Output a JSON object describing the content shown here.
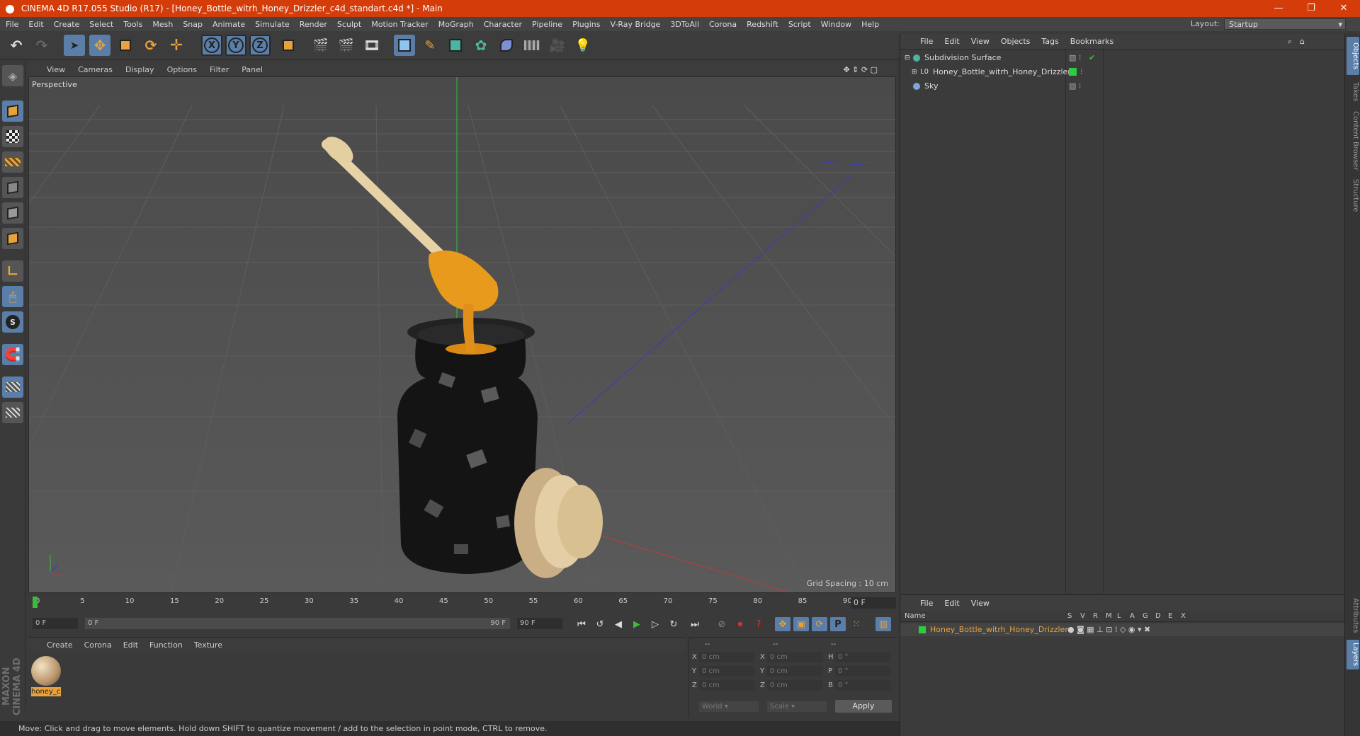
{
  "window": {
    "title": "CINEMA 4D R17.055 Studio (R17) - [Honey_Bottle_witrh_Honey_Drizzler_c4d_standart.c4d *] - Main",
    "minimize": "—",
    "restore": "❐",
    "close": "✕"
  },
  "menu": [
    "File",
    "Edit",
    "Create",
    "Select",
    "Tools",
    "Mesh",
    "Snap",
    "Animate",
    "Simulate",
    "Render",
    "Sculpt",
    "Motion Tracker",
    "MoGraph",
    "Character",
    "Pipeline",
    "Plugins",
    "V-Ray Bridge",
    "3DToAll",
    "Corona",
    "Redshift",
    "Script",
    "Window",
    "Help"
  ],
  "layout": {
    "label": "Layout:",
    "value": "Startup"
  },
  "toolbar": {
    "x_label": "X",
    "y_label": "Y",
    "z_label": "Z"
  },
  "viewport": {
    "menu": [
      "View",
      "Cameras",
      "Display",
      "Options",
      "Filter",
      "Panel"
    ],
    "label": "Perspective",
    "grid_spacing": "Grid Spacing : 10 cm"
  },
  "timeline": {
    "ticks": [
      "0",
      "5",
      "10",
      "15",
      "20",
      "25",
      "30",
      "35",
      "40",
      "45",
      "50",
      "55",
      "60",
      "65",
      "70",
      "75",
      "80",
      "85",
      "90"
    ],
    "current_frame": "0 F",
    "start_field": "0 F",
    "range_start": "0 F",
    "range_end": "90 F",
    "end_field": "90 F"
  },
  "materials": {
    "menu": [
      "Create",
      "Corona",
      "Edit",
      "Function",
      "Texture"
    ],
    "items": [
      {
        "name": "honey_c"
      }
    ]
  },
  "coords": {
    "header": [
      "--",
      "--",
      "--"
    ],
    "rows": [
      {
        "a": "X",
        "av": "0 cm",
        "b": "X",
        "bv": "0 cm",
        "c": "H",
        "cv": "0 °"
      },
      {
        "a": "Y",
        "av": "0 cm",
        "b": "Y",
        "bv": "0 cm",
        "c": "P",
        "cv": "0 °"
      },
      {
        "a": "Z",
        "av": "0 cm",
        "b": "Z",
        "bv": "0 cm",
        "c": "B",
        "cv": "0 °"
      }
    ],
    "world": "World",
    "scale": "Scale",
    "apply": "Apply"
  },
  "status": "Move: Click and drag to move elements. Hold down SHIFT to quantize movement / add to the selection in point mode, CTRL to remove.",
  "branding": "MAXON CINEMA 4D",
  "objects": {
    "menu": [
      "File",
      "Edit",
      "View",
      "Objects",
      "Tags",
      "Bookmarks"
    ],
    "items": [
      {
        "name": "Subdivision Surface",
        "color": "#4bb5a0"
      },
      {
        "name": "Honey_Bottle_witrh_Honey_Drizzler",
        "color": "#cccccc"
      },
      {
        "name": "Sky",
        "color": "#7fa6d6"
      }
    ]
  },
  "layers": {
    "menu": [
      "File",
      "Edit",
      "View"
    ],
    "name_header": "Name",
    "flags": [
      "S",
      "V",
      "R",
      "M",
      "L",
      "A",
      "G",
      "D",
      "E",
      "X"
    ],
    "row_name": "Honey_Bottle_witrh_Honey_Drizzler",
    "row_color": "#2ecc40"
  },
  "right_tabs": [
    "Objects",
    "Takes",
    "Content Browser",
    "Structure",
    "Attributes",
    "Layers"
  ],
  "colors": {
    "accent": "#d43d0a",
    "selection": "#5b7ea8",
    "highlight": "#e8a23a"
  }
}
